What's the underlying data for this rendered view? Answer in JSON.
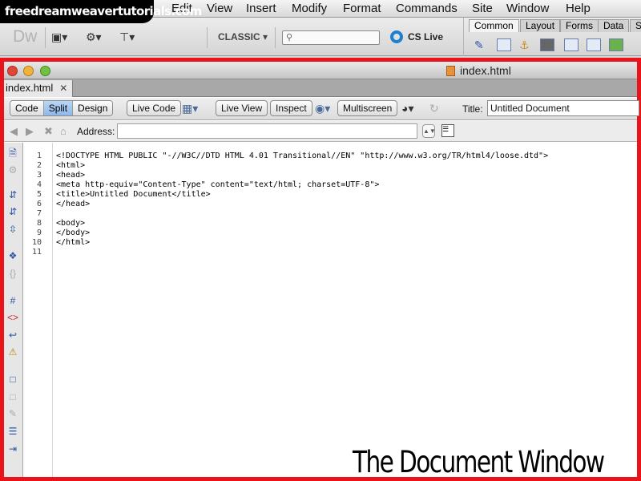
{
  "watermark": "freedreamweavertutorials.com",
  "menubar": {
    "items": [
      "Edit",
      "View",
      "Insert",
      "Modify",
      "Format",
      "Commands",
      "Site",
      "Window",
      "Help"
    ]
  },
  "appbar": {
    "logo": "Dw",
    "workspace": "CLASSIC ▾",
    "search_value": "",
    "cs_live": "CS Live",
    "insert_tabs": [
      "Common",
      "Layout",
      "Forms",
      "Data",
      "S"
    ]
  },
  "document": {
    "window_title": "index.html",
    "tab_label": "index.html",
    "view_buttons": [
      "Code",
      "Split",
      "Design"
    ],
    "active_view": "Split",
    "live_code": "Live Code",
    "live_view": "Live View",
    "inspect": "Inspect",
    "multiscreen": "Multiscreen",
    "title_label": "Title:",
    "title_value": "Untitled Document",
    "address_label": "Address:",
    "address_value": ""
  },
  "code": {
    "line_numbers": [
      "1",
      "2",
      "3",
      "4",
      "5",
      "6",
      "7",
      "8",
      "9",
      "10",
      "11"
    ],
    "lines": [
      "<!DOCTYPE HTML PUBLIC \"-//W3C//DTD HTML 4.01 Transitional//EN\" \"http://www.w3.org/TR/html4/loose.dtd\">",
      "<html>",
      "<head>",
      "<meta http-equiv=\"Content-Type\" content=\"text/html; charset=UTF-8\">",
      "<title>Untitled Document</title>",
      "</head>",
      "",
      "<body>",
      "</body>",
      "</html>",
      ""
    ]
  },
  "caption": "The Document Window",
  "colors": {
    "frame_highlight": "#e8141a",
    "split_active": "#8db8ea"
  }
}
